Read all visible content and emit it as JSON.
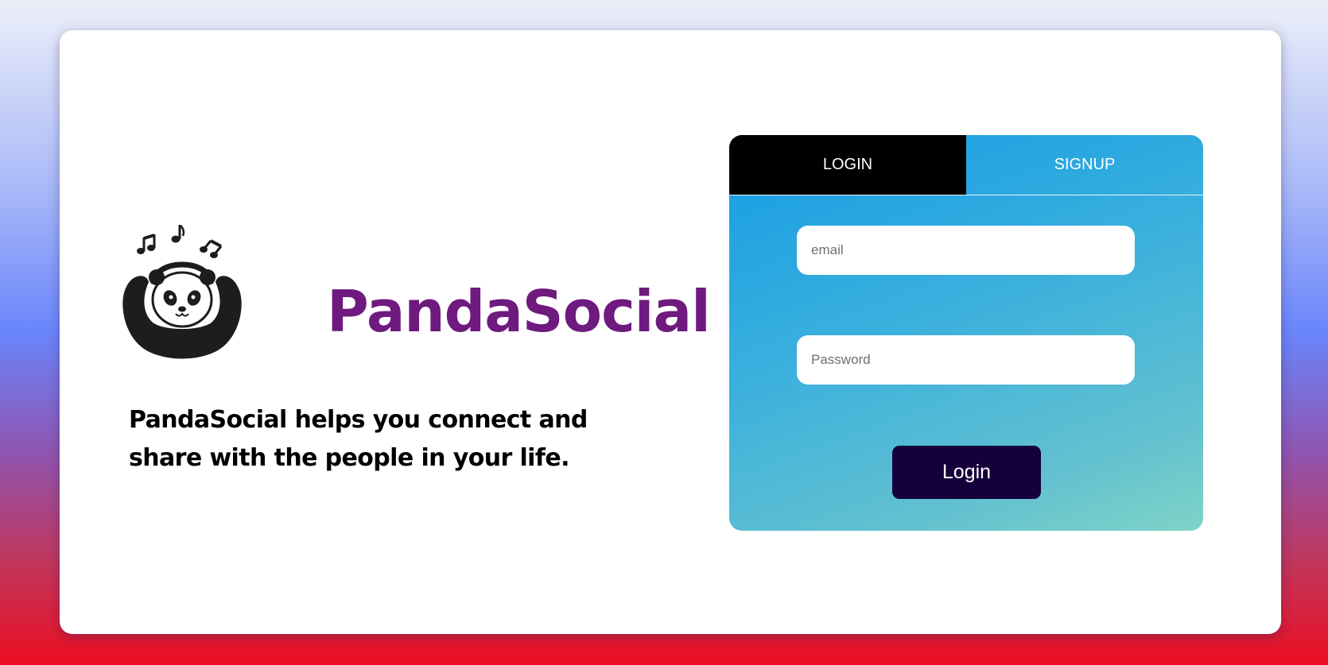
{
  "brand": {
    "name": "PandaSocial",
    "tagline": "PandaSocial helps you connect and share with the people in your life.",
    "logo_icon": "panda-headphones-music-icon",
    "name_color": "#6e1a7e"
  },
  "auth": {
    "tabs": [
      {
        "label": "LOGIN",
        "active": true
      },
      {
        "label": "SIGNUP",
        "active": false
      }
    ],
    "email": {
      "value": "",
      "placeholder": "email"
    },
    "password": {
      "value": "",
      "placeholder": "Password"
    },
    "submit_label": "Login"
  },
  "colors": {
    "tab_active_bg": "#000000",
    "panel_gradient_start": "#159ce4",
    "panel_gradient_end": "#7fd3c7",
    "button_bg": "#16003c"
  }
}
